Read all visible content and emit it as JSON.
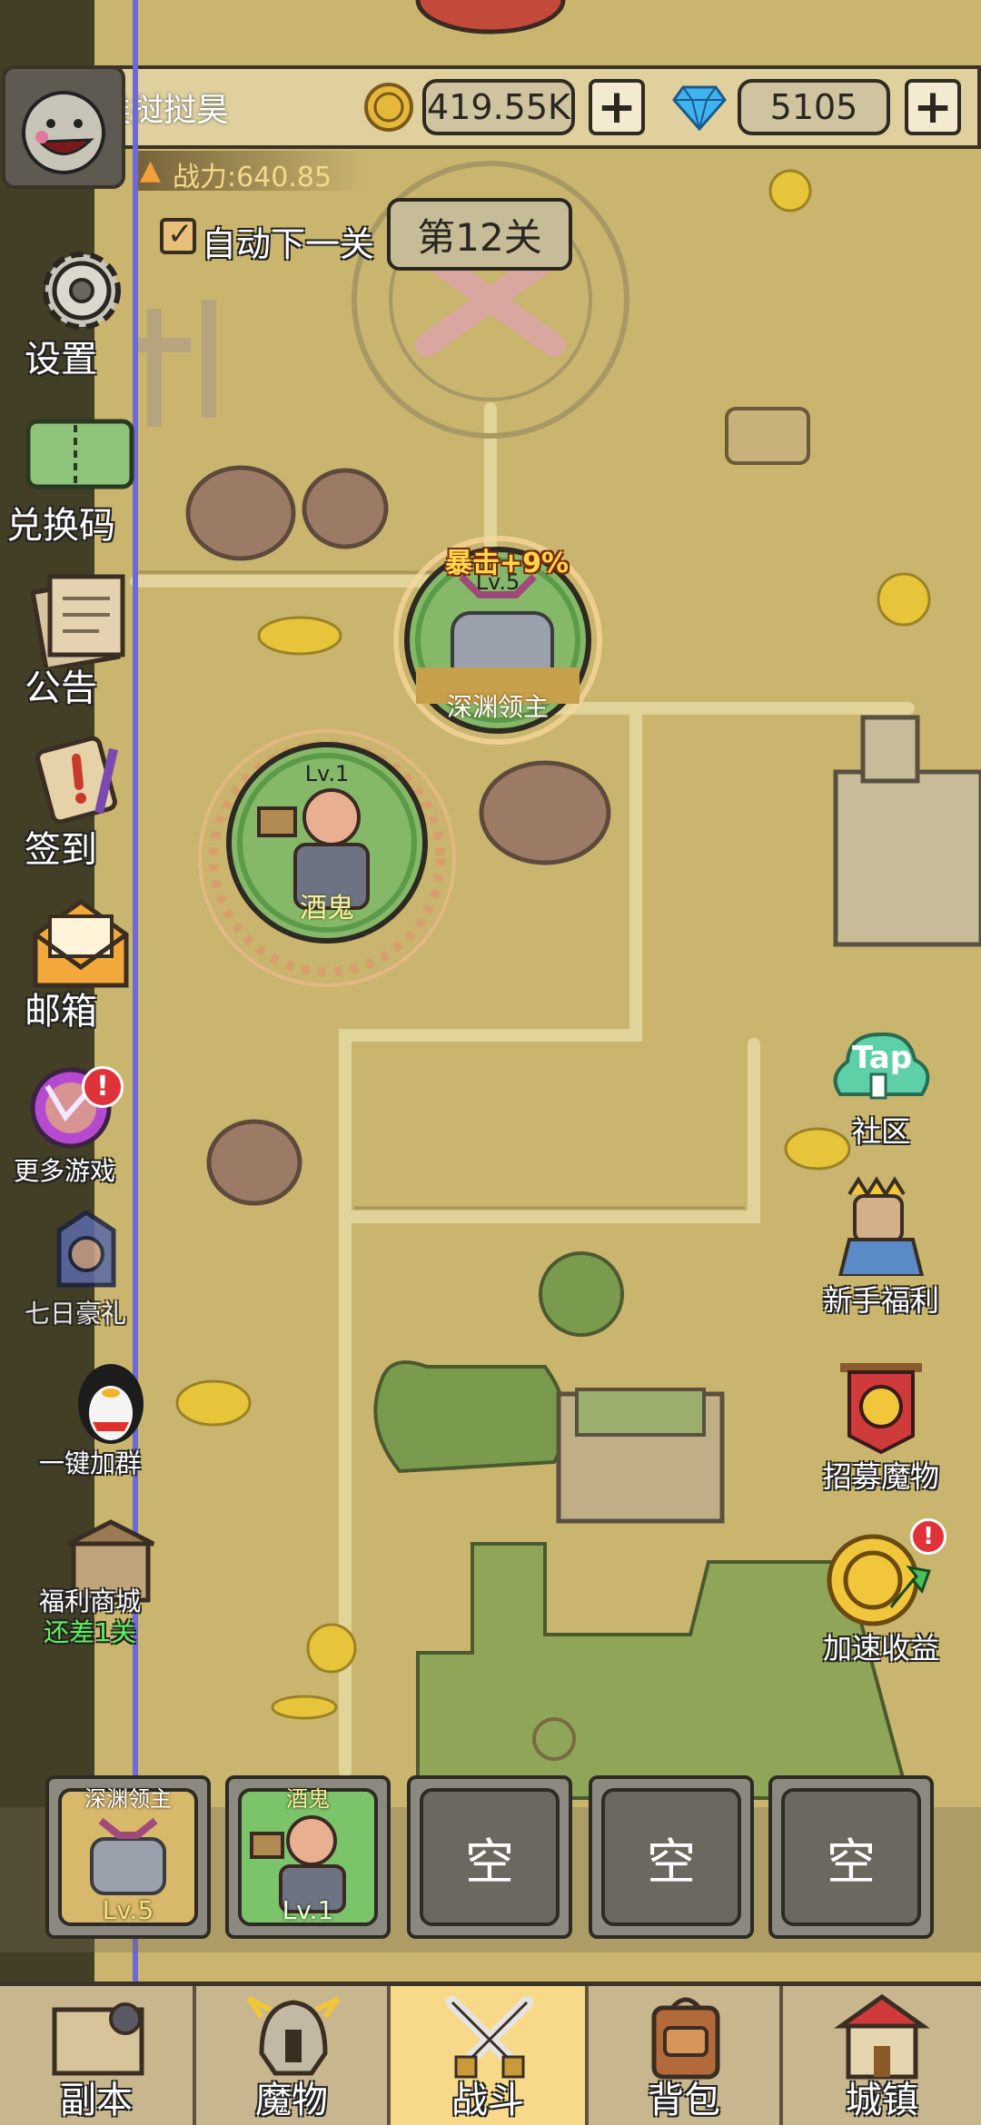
{
  "header": {
    "player_name": "彂挝挝昊",
    "gold": "419.55K",
    "gems": "5105",
    "power_label": "战力:640.85",
    "add_symbol": "+"
  },
  "stage": {
    "auto_next_label": "自动下一关",
    "auto_next_checked": true,
    "stage_label": "第12关"
  },
  "left_menu": [
    {
      "label": "设置",
      "icon": "gear-icon"
    },
    {
      "label": "兑换码",
      "icon": "ticket-icon"
    },
    {
      "label": "公告",
      "icon": "notice-paper-icon"
    },
    {
      "label": "签到",
      "icon": "scroll-icon"
    },
    {
      "label": "邮箱",
      "icon": "mail-icon"
    },
    {
      "label": "更多游戏",
      "icon": "more-games-icon",
      "badge": "!"
    },
    {
      "label": "七日豪礼",
      "icon": "seven-day-gift-icon"
    },
    {
      "label": "一键加群",
      "icon": "penguin-icon"
    },
    {
      "label": "福利商城",
      "sublabel": "还差1关",
      "icon": "shop-icon"
    }
  ],
  "right_menu": [
    {
      "label": "社区",
      "icon": "tap-community-icon",
      "tap_text": "Tap"
    },
    {
      "label": "新手福利",
      "icon": "hero-gift-icon"
    },
    {
      "label": "招募魔物",
      "icon": "recruit-banner-icon"
    },
    {
      "label": "加速收益",
      "icon": "speed-coin-icon",
      "badge": "!"
    }
  ],
  "units_on_map": [
    {
      "name": "深渊领主",
      "level": "Lv.5",
      "bonus": "暴击+9%"
    },
    {
      "name": "酒鬼",
      "level": "Lv.1"
    }
  ],
  "team_slots": [
    {
      "name": "深渊领主",
      "level": "Lv.5",
      "filled": true
    },
    {
      "name": "酒鬼",
      "level": "Lv.1",
      "filled": true
    },
    {
      "label": "空",
      "filled": false
    },
    {
      "label": "空",
      "filled": false
    },
    {
      "label": "空",
      "filled": false
    }
  ],
  "bottom_nav": [
    {
      "label": "副本",
      "icon": "map-icon"
    },
    {
      "label": "魔物",
      "icon": "monster-helmet-icon"
    },
    {
      "label": "战斗",
      "icon": "crossed-swords-icon",
      "active": true
    },
    {
      "label": "背包",
      "icon": "backpack-icon"
    },
    {
      "label": "城镇",
      "icon": "town-icon"
    }
  ],
  "colors": {
    "active_tab": "#f8d98a",
    "map_bg": "#c9b56e",
    "green_frame": "#6cc45e",
    "gold": "#f4c542"
  }
}
